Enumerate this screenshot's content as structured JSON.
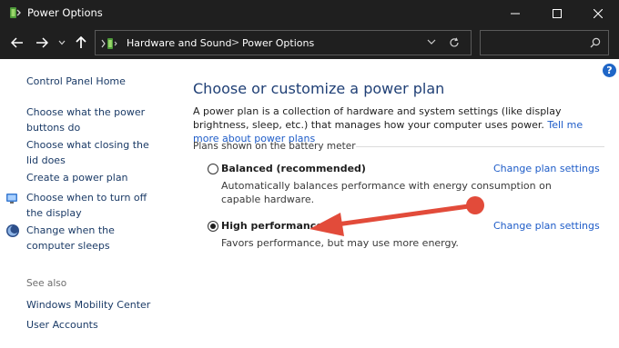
{
  "window": {
    "title": "Power Options"
  },
  "address": {
    "crumbs": [
      "Hardware and Sound",
      "Power Options"
    ],
    "separator": ">"
  },
  "search": {
    "placeholder": ""
  },
  "sidebar": {
    "items": [
      {
        "label": "Control Panel Home"
      },
      {
        "label": "Choose what the power buttons do"
      },
      {
        "label": "Choose what closing the lid does"
      },
      {
        "label": "Create a power plan"
      },
      {
        "label": "Choose when to turn off the display"
      },
      {
        "label": "Change when the computer sleeps"
      }
    ],
    "see_also": "See also",
    "see_also_items": [
      {
        "label": "Windows Mobility Center"
      },
      {
        "label": "User Accounts"
      }
    ]
  },
  "help": {
    "label": "?"
  },
  "main": {
    "title": "Choose or customize a power plan",
    "intro": "A power plan is a collection of hardware and system settings (like display brightness, sleep, etc.) that manages how your computer uses power.",
    "intro_link": "Tell me more about power plans",
    "group_header": "Plans shown on the battery meter",
    "plans": [
      {
        "name": "Balanced (recommended)",
        "description": "Automatically balances performance with energy consumption on capable hardware.",
        "selected": false,
        "link": "Change plan settings"
      },
      {
        "name": "High performance",
        "description": "Favors performance, but may use more energy.",
        "selected": true,
        "link": "Change plan settings"
      }
    ]
  },
  "colors": {
    "titlebar": "#1f1f1f",
    "link": "#1e5cc8",
    "heading": "#1f3f75",
    "annotation_arrow": "#e24b3a"
  }
}
